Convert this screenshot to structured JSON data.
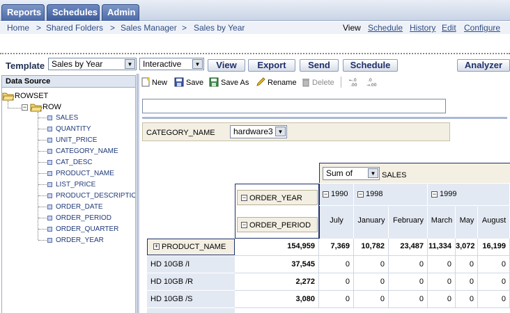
{
  "tabs": [
    {
      "label": "Reports"
    },
    {
      "label": "Schedules"
    },
    {
      "label": "Admin"
    }
  ],
  "breadcrumb": [
    "Home",
    "Shared Folders",
    "Sales Manager",
    "Sales by Year"
  ],
  "breadcrumb_sep": ">",
  "view_label": "View",
  "view_links": [
    "Schedule",
    "History",
    "Edit",
    "Configure"
  ],
  "toolbar": {
    "template_label": "Template",
    "template_value": "Sales by Year",
    "mode_value": "Interactive",
    "buttons": [
      "View",
      "Export",
      "Send",
      "Schedule"
    ],
    "analyzer": "Analyzer"
  },
  "datasource": {
    "title": "Data Source",
    "root": "ROWSET",
    "row": "ROW",
    "fields": [
      "SALES",
      "QUANTITY",
      "UNIT_PRICE",
      "CATEGORY_NAME",
      "CAT_DESC",
      "PRODUCT_NAME",
      "LIST_PRICE",
      "PRODUCT_DESCRIPTIO",
      "ORDER_DATE",
      "ORDER_PERIOD",
      "ORDER_QUARTER",
      "ORDER_YEAR"
    ]
  },
  "editor_toolbar": {
    "new": "New",
    "save": "Save",
    "save_as": "Save As",
    "rename": "Rename",
    "delete": "Delete"
  },
  "filter": {
    "label": "CATEGORY_NAME",
    "value": "hardware3"
  },
  "pivot": {
    "measure_agg": "Sum of",
    "measure": "SALES",
    "col_fields": [
      "ORDER_YEAR",
      "ORDER_PERIOD"
    ],
    "row_field": "PRODUCT_NAME",
    "years": [
      "1990",
      "1998",
      "1999"
    ],
    "months": [
      "July",
      "January",
      "February",
      "March",
      "May",
      "August"
    ],
    "totals": [
      "154,959",
      "7,369",
      "10,782",
      "23,487",
      "11,334",
      "3,072",
      "16,199"
    ],
    "rows": [
      {
        "name": "HD 10GB /I",
        "values": [
          "37,545",
          "0",
          "0",
          "0",
          "0",
          "0",
          "0"
        ]
      },
      {
        "name": "HD 10GB /R",
        "values": [
          "2,272",
          "0",
          "0",
          "0",
          "0",
          "0",
          "0"
        ]
      },
      {
        "name": "HD 10GB /S",
        "values": [
          "3,080",
          "0",
          "0",
          "0",
          "0",
          "0",
          "0"
        ]
      }
    ]
  }
}
